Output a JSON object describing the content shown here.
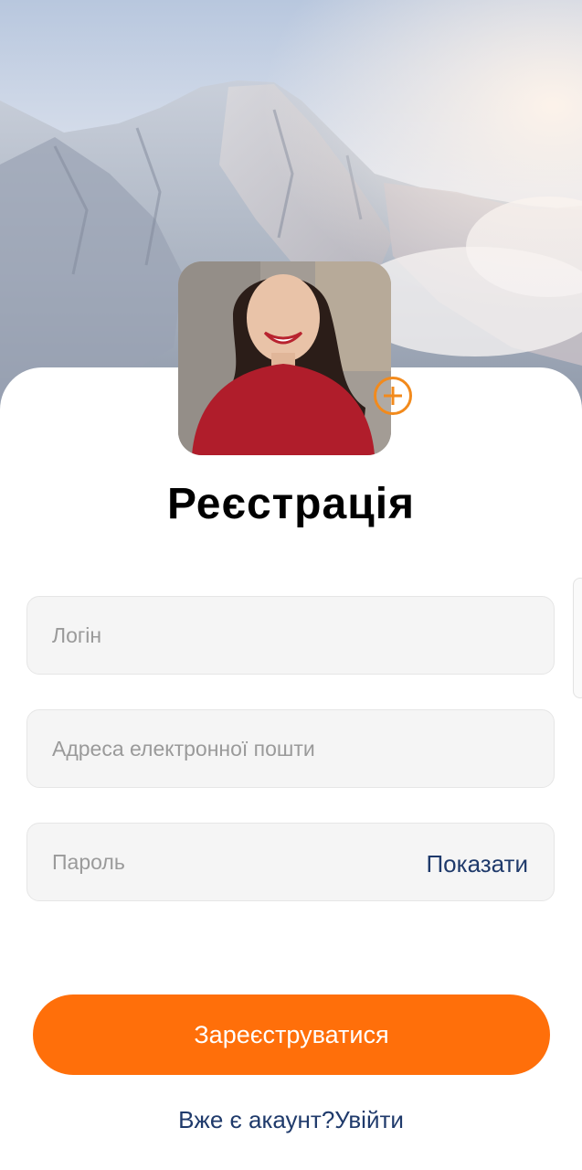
{
  "header": {
    "title": "Реєстрація"
  },
  "form": {
    "login_placeholder": "Логін",
    "email_placeholder": "Адреса електронної пошти",
    "password_placeholder": "Пароль",
    "show_password_label": "Показати"
  },
  "actions": {
    "register_label": "Зареєструватися",
    "have_account_text": "Вже є акаунт?",
    "sign_in_label": "Увійти"
  },
  "colors": {
    "accent": "#ff6f0a",
    "link": "#1f3a6b",
    "add_photo": "#f28a1c"
  }
}
